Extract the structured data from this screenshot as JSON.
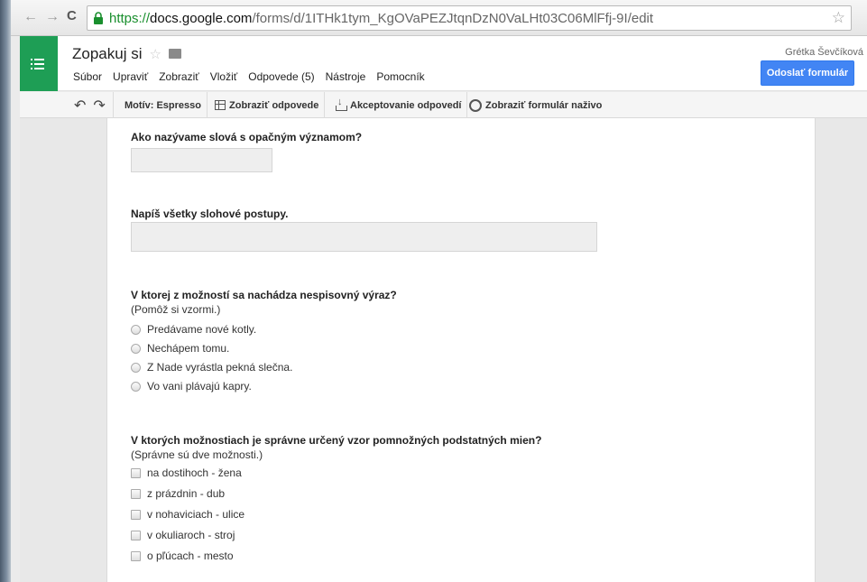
{
  "browser": {
    "url_protocol": "https://",
    "url_host": "docs.google.com",
    "url_path": "/forms/d/1ITHk1tym_KgOVaPEZJtqnDzN0VaLHt03C06MlFfj-9I/edit"
  },
  "app": {
    "doc_title": "Zopakuj si",
    "menu": [
      "Súbor",
      "Upraviť",
      "Zobraziť",
      "Vložiť",
      "Odpovede (5)",
      "Nástroje",
      "Pomocník"
    ],
    "user_name": "Grétka Ševčíková",
    "send_button": "Odoslať formulár"
  },
  "toolbar": {
    "theme": "Motív: Espresso",
    "view_responses": "Zobraziť odpovede",
    "accepting": "Akceptovanie odpovedí",
    "view_live": "Zobraziť formulár naživo"
  },
  "questions": [
    {
      "title": "Ako nazývame slová s opačným významom?",
      "type": "text"
    },
    {
      "title": "Napíš všetky slohové postupy.",
      "type": "paragraph"
    },
    {
      "title": "V ktorej z možností sa nachádza nespisovný výraz?",
      "help": "(Pomôž si vzormi.)",
      "type": "radio",
      "options": [
        "Predávame nové kotly.",
        "Nechápem tomu.",
        "Z Nade vyrástla pekná slečna.",
        "Vo vani plávajú kapry."
      ]
    },
    {
      "title": "V ktorých možnostiach je správne určený vzor pomnožných podstatných mien?",
      "help": "(Správne sú dve možnosti.)",
      "type": "checkbox",
      "options": [
        "na dostihoch - žena",
        "z prázdnin - dub",
        "v nohaviciach - ulice",
        "v okuliaroch - stroj",
        "o pľúcach - mesto"
      ]
    }
  ]
}
